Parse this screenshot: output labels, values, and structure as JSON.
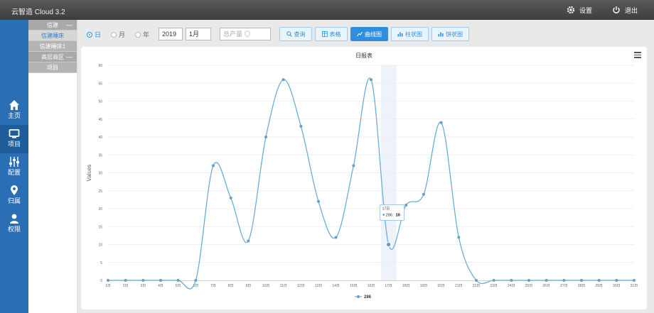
{
  "app": {
    "title": "云智造 Cloud 3.2",
    "settings_label": "设置",
    "logout_label": "退出"
  },
  "nav": [
    {
      "label": "主页",
      "icon": "home-icon"
    },
    {
      "label": "项目",
      "icon": "monitor-icon"
    },
    {
      "label": "配置",
      "icon": "sliders-icon"
    },
    {
      "label": "归属",
      "icon": "location-pin-icon"
    },
    {
      "label": "权限",
      "icon": "user-icon"
    }
  ],
  "tree": {
    "items": [
      {
        "label": "信建",
        "toggle": "—"
      },
      {
        "label": "信建睡床",
        "toggle": ""
      },
      {
        "label": "信建睡床1",
        "toggle": ""
      },
      {
        "label": "高层商区",
        "toggle": "—"
      },
      {
        "label": "项目",
        "toggle": ""
      }
    ]
  },
  "toolbar": {
    "radios": [
      "日",
      "月",
      "年"
    ],
    "year_value": "2019",
    "month_value": "1月",
    "total_placeholder": "总产量 ◎",
    "buttons": [
      "查询",
      "表格",
      "曲线图",
      "柱状图",
      "饼状图"
    ]
  },
  "chart_data": {
    "type": "line",
    "title": "日报表",
    "ylabel": "Values",
    "ylim": [
      0,
      60
    ],
    "yticks": [
      0,
      5,
      10,
      15,
      20,
      25,
      30,
      35,
      40,
      45,
      50,
      55,
      60
    ],
    "categories": [
      "1日",
      "2日",
      "3日",
      "4日",
      "5日",
      "6日",
      "7日",
      "8日",
      "9日",
      "10日",
      "11日",
      "12日",
      "13日",
      "14日",
      "15日",
      "16日",
      "17日",
      "18日",
      "19日",
      "20日",
      "21日",
      "22日",
      "23日",
      "24日",
      "25日",
      "26日",
      "27日",
      "28日",
      "29日",
      "30日",
      "31日"
    ],
    "series": [
      {
        "name": "286",
        "values": [
          0,
          0,
          0,
          0,
          0,
          0,
          32,
          23,
          11,
          40,
          56,
          43,
          22,
          12,
          32,
          56,
          10,
          21,
          24,
          44,
          12,
          0,
          0,
          0,
          0,
          0,
          0,
          0,
          0,
          0,
          0
        ]
      }
    ],
    "highlight_index": 16,
    "tooltip": {
      "header": "17日",
      "series": "286",
      "value": "10"
    },
    "legend_position": "bottom",
    "colors": {
      "line": "#6aaed6",
      "marker": "#6a9ec0"
    }
  }
}
